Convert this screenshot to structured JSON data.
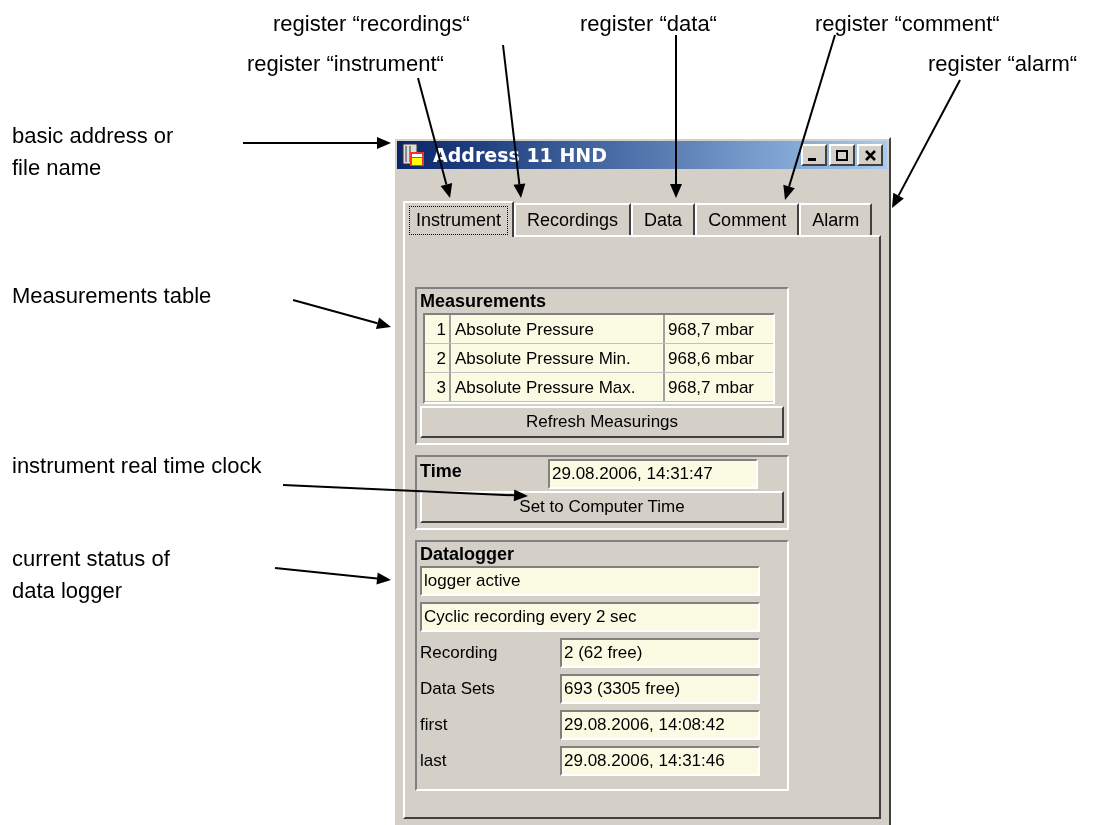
{
  "annotations": [
    {
      "kind": "top",
      "text": "register “recordings“"
    },
    {
      "kind": "top",
      "text": "register “instrument“"
    },
    {
      "kind": "top",
      "text": "register “data“"
    },
    {
      "kind": "top",
      "text": "register “comment“"
    },
    {
      "kind": "top",
      "text": "register “alarm“"
    },
    {
      "kind": "side",
      "text": "basic address or file name"
    },
    {
      "kind": "side",
      "text": "Measurements table"
    },
    {
      "kind": "side",
      "text": "instrument real time clock"
    },
    {
      "kind": "side",
      "text": "current status of data logger"
    }
  ],
  "window": {
    "title": "Address 11 HND"
  },
  "tabs": [
    {
      "label": "Instrument",
      "selected": true
    },
    {
      "label": "Recordings",
      "selected": false
    },
    {
      "label": "Data",
      "selected": false
    },
    {
      "label": "Comment",
      "selected": false
    },
    {
      "label": "Alarm",
      "selected": false
    }
  ],
  "measurements": {
    "title": "Measurements",
    "rows": [
      {
        "index": "1",
        "name": "Absolute Pressure",
        "value": "968,7 mbar"
      },
      {
        "index": "2",
        "name": "Absolute Pressure Min.",
        "value": "968,6 mbar"
      },
      {
        "index": "3",
        "name": "Absolute Pressure Max.",
        "value": "968,7 mbar"
      }
    ],
    "button": "Refresh Measurings"
  },
  "time": {
    "title": "Time",
    "value": "29.08.2006, 14:31:47",
    "button": "Set to Computer Time"
  },
  "datalogger": {
    "title": "Datalogger",
    "status": [
      "logger active",
      "Cyclic recording every 2 sec"
    ],
    "fields": [
      {
        "label": "Recording",
        "value": "2 (62 free)"
      },
      {
        "label": "Data Sets",
        "value": "693 (3305 free)"
      },
      {
        "label": "first",
        "value": "29.08.2006, 14:08:42"
      },
      {
        "label": "last",
        "value": "29.08.2006, 14:31:46"
      }
    ]
  }
}
